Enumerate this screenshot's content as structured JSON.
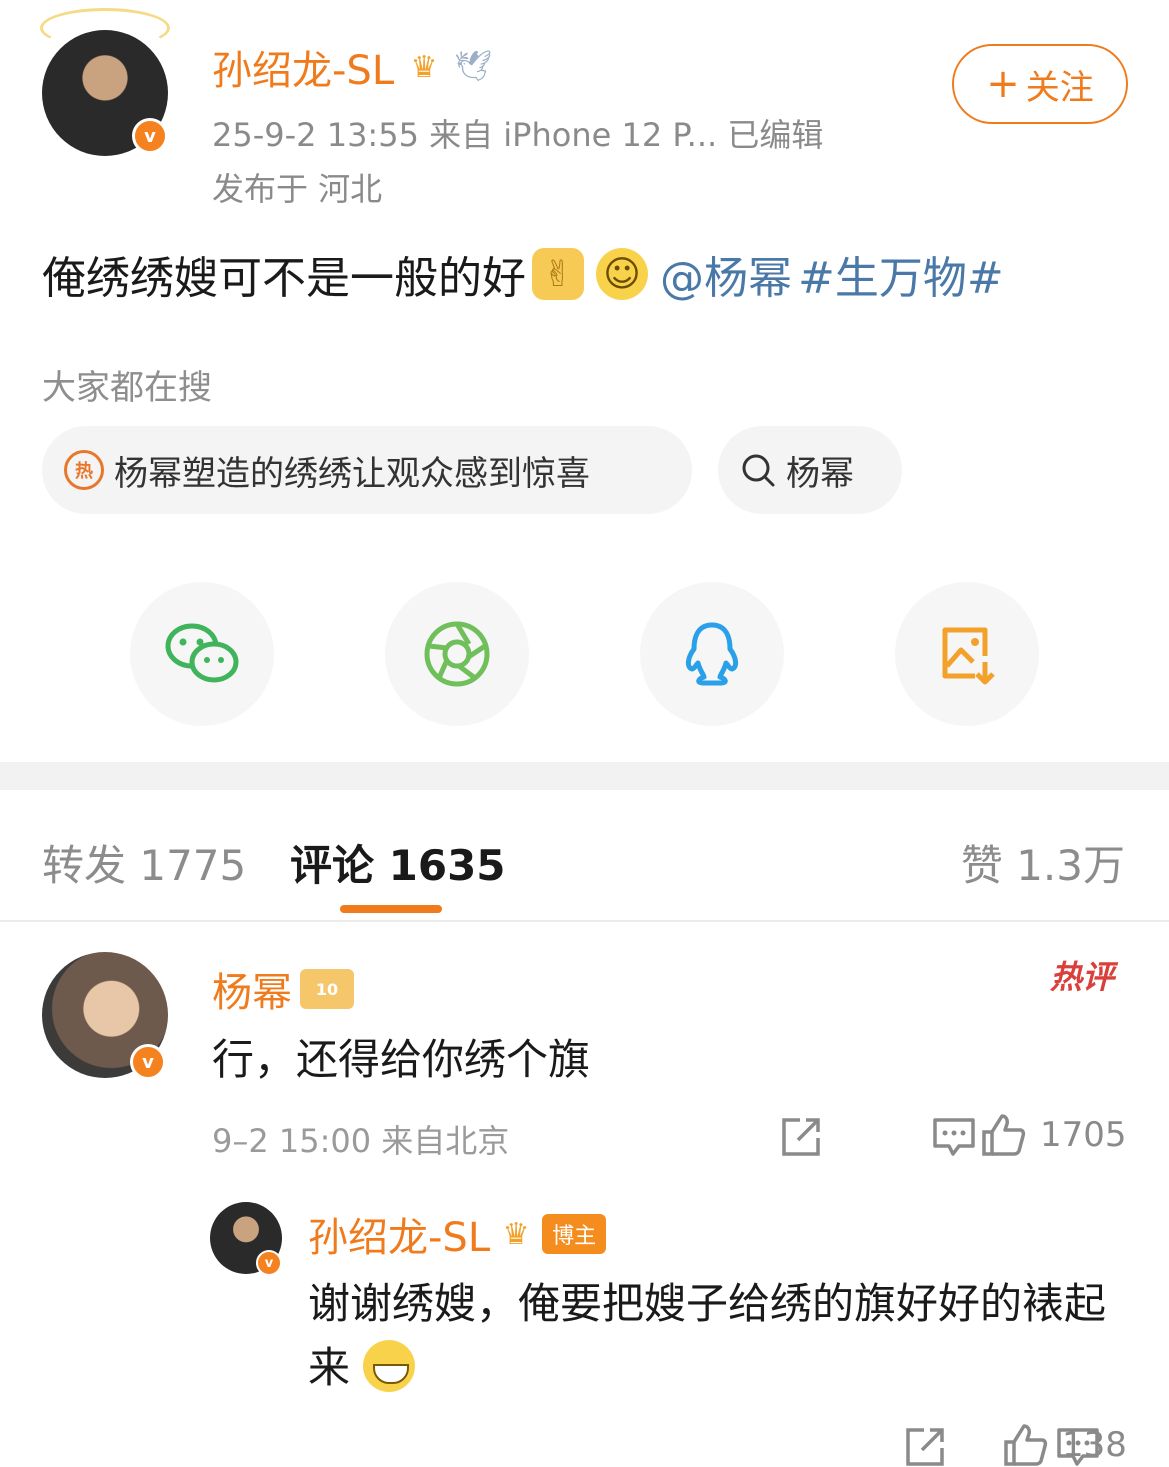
{
  "post": {
    "author": "孙绍龙-SL",
    "meta_line": "25-9-2 13:55  来自 iPhone 12 P...  已编辑",
    "location": "发布于 河北",
    "follow_label": "关注",
    "text": "俺绣绣嫂可不是一般的好",
    "mention": "@杨幂",
    "topic": "#生万物#",
    "v_badge": "v"
  },
  "search": {
    "hint": "大家都在搜",
    "chips": [
      {
        "label": "杨幂塑造的绣绣让观众感到惊喜",
        "icon": "hot-search-icon",
        "hot_glyph": "热"
      },
      {
        "label": "杨幂",
        "icon": "search-icon"
      }
    ]
  },
  "share": {
    "targets": [
      {
        "name": "wechat",
        "color": "#3fb45a"
      },
      {
        "name": "moments",
        "color": "#6fbf5a"
      },
      {
        "name": "qq",
        "color": "#2aa0e8"
      },
      {
        "name": "save-image",
        "color": "#f2a12b"
      }
    ]
  },
  "tabs": {
    "forward": "转发 1775",
    "comment": "评论 1635",
    "like": "赞 1.3万"
  },
  "comments": [
    {
      "author": "杨幂",
      "level_badge": "10",
      "hot_badge": "热评",
      "text": "行，还得给你绣个旗",
      "meta": "9–2 15:00  来自北京",
      "likes": "1705"
    }
  ],
  "reply": {
    "author": "孙绍龙-SL",
    "role_badge": "博主",
    "text": "谢谢绣嫂，俺要把嫂子给绣的旗好好的裱起来",
    "likes": "138"
  },
  "colors": {
    "accent": "#f07b1d",
    "link": "#4a79a8",
    "hot": "#d9403b"
  }
}
